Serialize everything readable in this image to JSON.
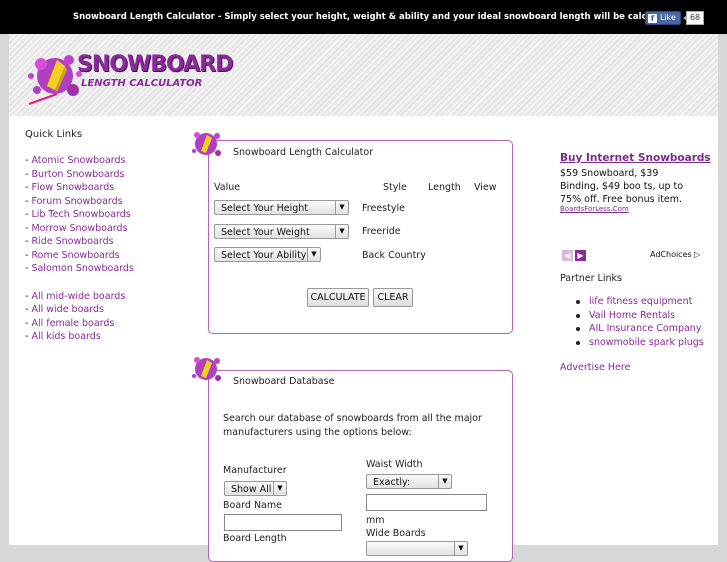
{
  "topbar": {
    "message": "Snowboard Length Calculator - Simply select your height, weight & ability and your ideal snowboard length will be calculated.",
    "fb_like": "Like",
    "fb_count": "68"
  },
  "logo": {
    "line1": "SNOWBOARD",
    "line2": "LENGTH CALCULATOR"
  },
  "quick_links": {
    "heading": "Quick Links",
    "brands": [
      "Atomic Snowboards",
      "Burton Snowboards",
      "Flow Snowboards",
      "Forum Snowboards",
      "Lib Tech Snowboards",
      "Morrow Snowboards",
      "Ride Snowboards",
      "Rome Snowboards",
      "Salomon Snowboards"
    ],
    "categories": [
      "All mid-wide boards",
      "All wide boards",
      "All female boards",
      "All kids boards"
    ]
  },
  "calculator": {
    "title": "Snowboard Length Calculator",
    "col_value": "Value",
    "col_style": "Style",
    "col_length": "Length",
    "col_view": "View",
    "height_select": "Select Your Height",
    "weight_select": "Select Your Weight",
    "ability_select": "Select Your Ability",
    "styles": [
      "Freestyle",
      "Freeride",
      "Back Country"
    ],
    "calculate_label": "CALCULATE",
    "clear_label": "CLEAR"
  },
  "database": {
    "title": "Snowboard Database",
    "intro": "Search our database of snowboards from all the major manufacturers using the options below:",
    "manufacturer_label": "Manufacturer",
    "manufacturer_value": "Show All",
    "board_name_label": "Board Name",
    "board_length_label": "Board Length",
    "waist_width_label": "Waist Width",
    "waist_width_value": "Exactly:",
    "waist_unit": "mm",
    "wide_boards_label": "Wide Boards"
  },
  "sidebar_right": {
    "ad_title": "Buy Internet Snowboards",
    "ad_body": "$59 Snowboard, $39 Binding, $49 boo ts, up to 75% off. Free bonus item.",
    "ad_url": "BoardsForLess.Com",
    "adchoices": "AdChoices",
    "partner_heading": "Partner Links",
    "partners": [
      "life fitness equipment",
      "Vail Home Rentals",
      "AIL Insurance Company",
      "snowmobile spark plugs"
    ],
    "advertise": "Advertise Here"
  },
  "colors": {
    "accent": "#8a2a9a",
    "panel_border": "#b463b8",
    "topbar": "#000000"
  }
}
